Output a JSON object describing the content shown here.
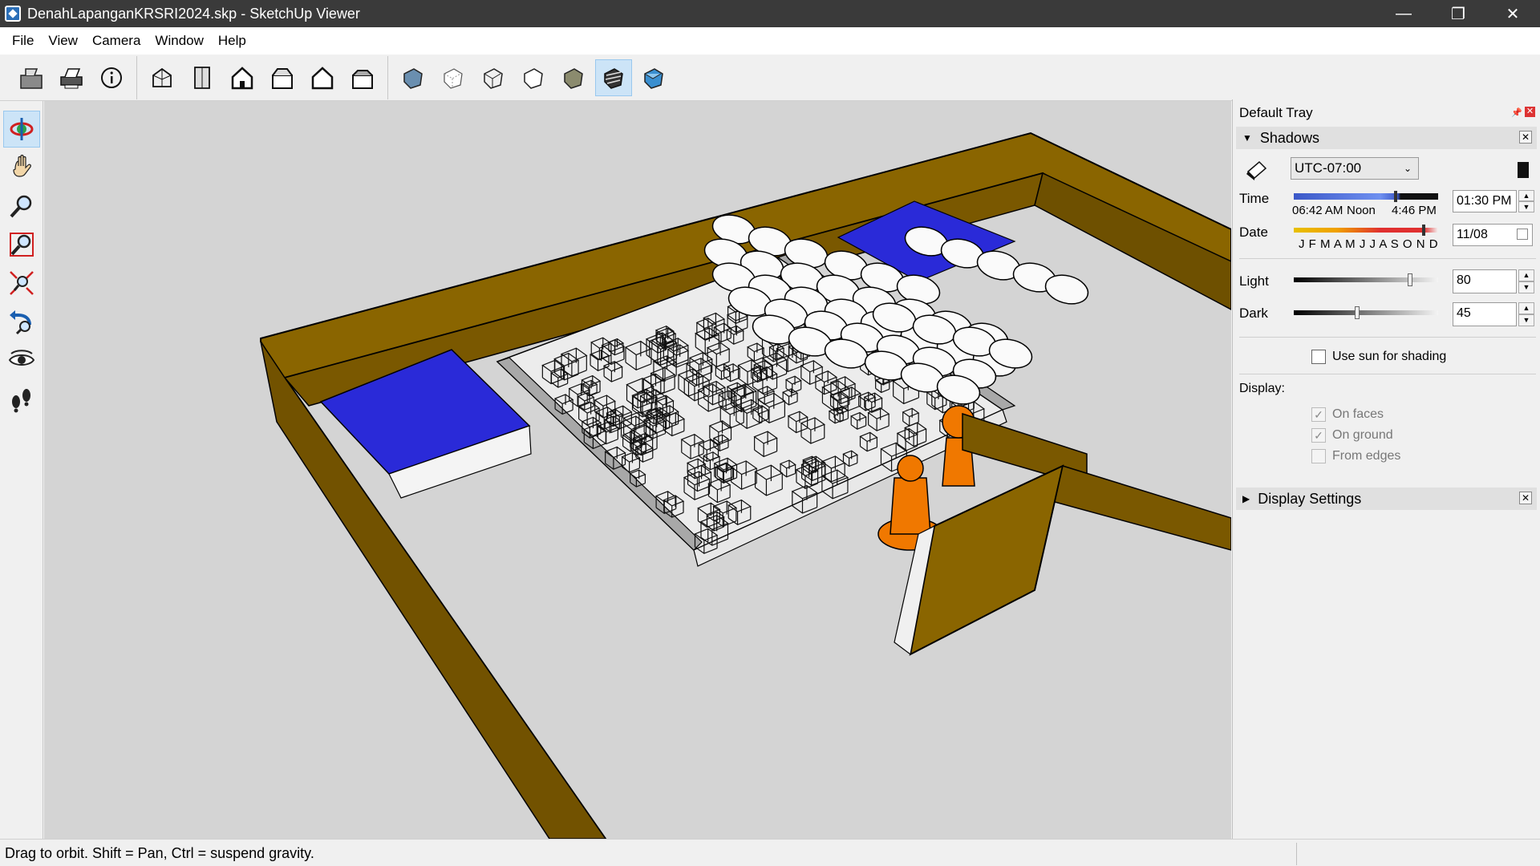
{
  "window": {
    "title": "DenahLapanganKRSRI2024.skp - SketchUp Viewer",
    "minimize": "—",
    "maximize": "❐",
    "close": "✕"
  },
  "menu": [
    "File",
    "View",
    "Camera",
    "Window",
    "Help"
  ],
  "toolbar": {
    "groups": [
      [
        "open-icon",
        "print-icon",
        "model-info-icon"
      ],
      [
        "iso-view-icon",
        "top-view-icon",
        "front-view-icon",
        "right-view-icon",
        "back-view-icon",
        "left-view-icon"
      ],
      [
        "xray-icon",
        "back-edges-icon",
        "wireframe-icon",
        "hidden-line-icon",
        "shaded-icon",
        "shaded-textures-icon",
        "monochrome-icon"
      ]
    ],
    "active": "shaded-textures-icon"
  },
  "left_tools": [
    "orbit-icon",
    "pan-icon",
    "zoom-icon",
    "zoom-window-icon",
    "zoom-extents-icon",
    "previous-view-icon",
    "look-around-icon",
    "walk-icon"
  ],
  "left_tools_active": "orbit-icon",
  "tray": {
    "title": "Default Tray",
    "shadows": {
      "header": "Shadows",
      "timezone": "UTC-07:00",
      "time_label": "Time",
      "time_sunrise": "06:42 AM",
      "time_noon": "Noon",
      "time_sunset": "4:46 PM",
      "time_value": "01:30 PM",
      "date_label": "Date",
      "months": "J F M A M J J A S O N D",
      "date_value": "11/08",
      "light_label": "Light",
      "light_value": "80",
      "dark_label": "Dark",
      "dark_value": "45",
      "use_sun_label": "Use sun for shading",
      "use_sun_checked": false,
      "display_label": "Display:",
      "on_faces_label": "On faces",
      "on_faces_checked": true,
      "on_ground_label": "On ground",
      "on_ground_checked": true,
      "from_edges_label": "From edges",
      "from_edges_checked": false
    },
    "display_settings": {
      "header": "Display Settings"
    }
  },
  "status": {
    "text": "Drag to orbit. Shift = Pan, Ctrl = suspend gravity."
  },
  "colors": {
    "wall_top": "#8a6500",
    "wall_side": "#7a5800",
    "blue_pad": "#2a2ad8",
    "figure": "#f07800",
    "floor": "#d4d4d4"
  }
}
